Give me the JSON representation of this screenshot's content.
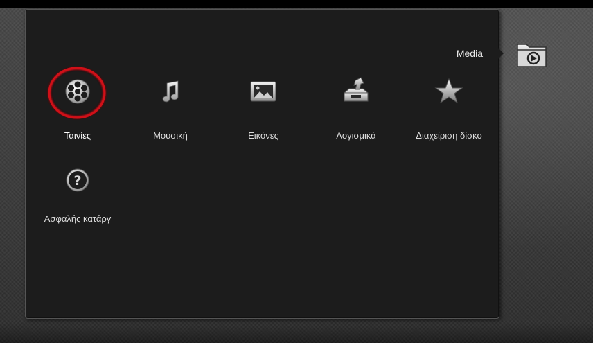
{
  "header": {
    "section_title": "Media",
    "section_icon": "media-folder-icon"
  },
  "menu": {
    "selected_index": 0,
    "items": [
      {
        "label": "Ταινίες",
        "icon": "film-reel-icon"
      },
      {
        "label": "Μουσική",
        "icon": "music-note-icon"
      },
      {
        "label": "Εικόνες",
        "icon": "picture-icon"
      },
      {
        "label": "Λογισμικά",
        "icon": "software-install-icon"
      },
      {
        "label": "Διαχείριση δίσκο",
        "icon": "star-icon"
      },
      {
        "label": "Ασφαλής κατάργ",
        "icon": "help-icon"
      }
    ]
  },
  "colors": {
    "focus_ring": "#c0101a",
    "panel_background": "#1c1c1c",
    "text": "#dddddd"
  }
}
